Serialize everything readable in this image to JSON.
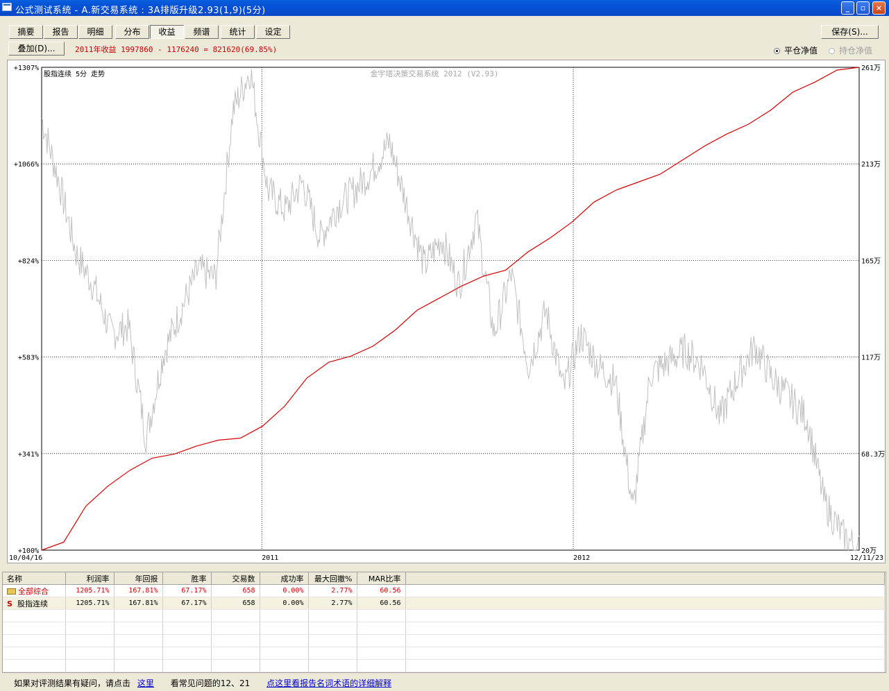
{
  "window": {
    "title": "公式测试系统 - A.新交易系统 : 3A排版升级2.93(1,9)(5分)"
  },
  "tabs": [
    {
      "label": "摘要",
      "active": false
    },
    {
      "label": "报告",
      "active": false
    },
    {
      "label": "明细",
      "active": false
    },
    {
      "label": "分布",
      "active": false
    },
    {
      "label": "收益",
      "active": true
    },
    {
      "label": "频谱",
      "active": false
    },
    {
      "label": "统计",
      "active": false
    },
    {
      "label": "设定",
      "active": false
    }
  ],
  "toolbar": {
    "save_label": "保存(S)...",
    "overlay_label": "叠加(D)...",
    "summary_text": "2011年收益 1997860 - 1176240 = 821620(69.85%)",
    "radio_flat": "平仓净值",
    "radio_hold": "持仓净值"
  },
  "chart_data": {
    "type": "line",
    "title": "金宇塔决策交易系统 2012 (V2.93)",
    "underlay_label": "股指连续 5分 走势",
    "left_ticks": [
      "+1307%",
      "+1066%",
      "+824%",
      "+583%",
      "+341%",
      "+100%"
    ],
    "right_ticks": [
      "261万",
      "213万",
      "165万",
      "117万",
      "68.3万",
      "20万"
    ],
    "x_ticks": [
      "10/04/16",
      "2011",
      "2012",
      "12/11/23"
    ],
    "grid": true,
    "colors": {
      "equity": "#d40000",
      "price": "#c0c0c0"
    },
    "series": [
      {
        "name": "平仓净值",
        "values": [
          100,
          120,
          210,
          260,
          300,
          330,
          340,
          360,
          375,
          380,
          410,
          460,
          530,
          570,
          585,
          610,
          650,
          700,
          730,
          760,
          785,
          800,
          845,
          880,
          920,
          970,
          1000,
          1020,
          1040,
          1075,
          1110,
          1140,
          1165,
          1200,
          1245,
          1270,
          1300,
          1307
        ]
      },
      {
        "values": [
          1180,
          1020,
          840,
          760,
          640,
          660,
          380,
          590,
          700,
          800,
          780,
          1200,
          1300,
          1000,
          950,
          1020,
          880,
          960,
          1000,
          1050,
          1120,
          960,
          810,
          880,
          760,
          930,
          640,
          790,
          560,
          700,
          500,
          640,
          560,
          520,
          200,
          540,
          570,
          600,
          560,
          430,
          530,
          610,
          530,
          480,
          430,
          220,
          140,
          100
        ]
      }
    ]
  },
  "results_table": {
    "headers": [
      "名称",
      "利润率",
      "年回报",
      "胜率",
      "交易数",
      "成功率",
      "最大回撤%",
      "MAR比率"
    ],
    "rows": [
      {
        "name": "全部综合",
        "icon": "folder-icon",
        "values": [
          "1205.71%",
          "167.81%",
          "67.17%",
          "658",
          "0.00%",
          "2.77%",
          "60.56"
        ]
      },
      {
        "name": "股指连续",
        "icon": "s-icon",
        "values": [
          "1205.71%",
          "167.81%",
          "67.17%",
          "658",
          "0.00%",
          "2.77%",
          "60.56"
        ]
      }
    ]
  },
  "footer": {
    "prefix": "如果对评测结果有疑问，请点击",
    "link1": "这里",
    "middle": "看常见问题的12、21",
    "link2": "点这里看报告名词术语的详细解释"
  }
}
